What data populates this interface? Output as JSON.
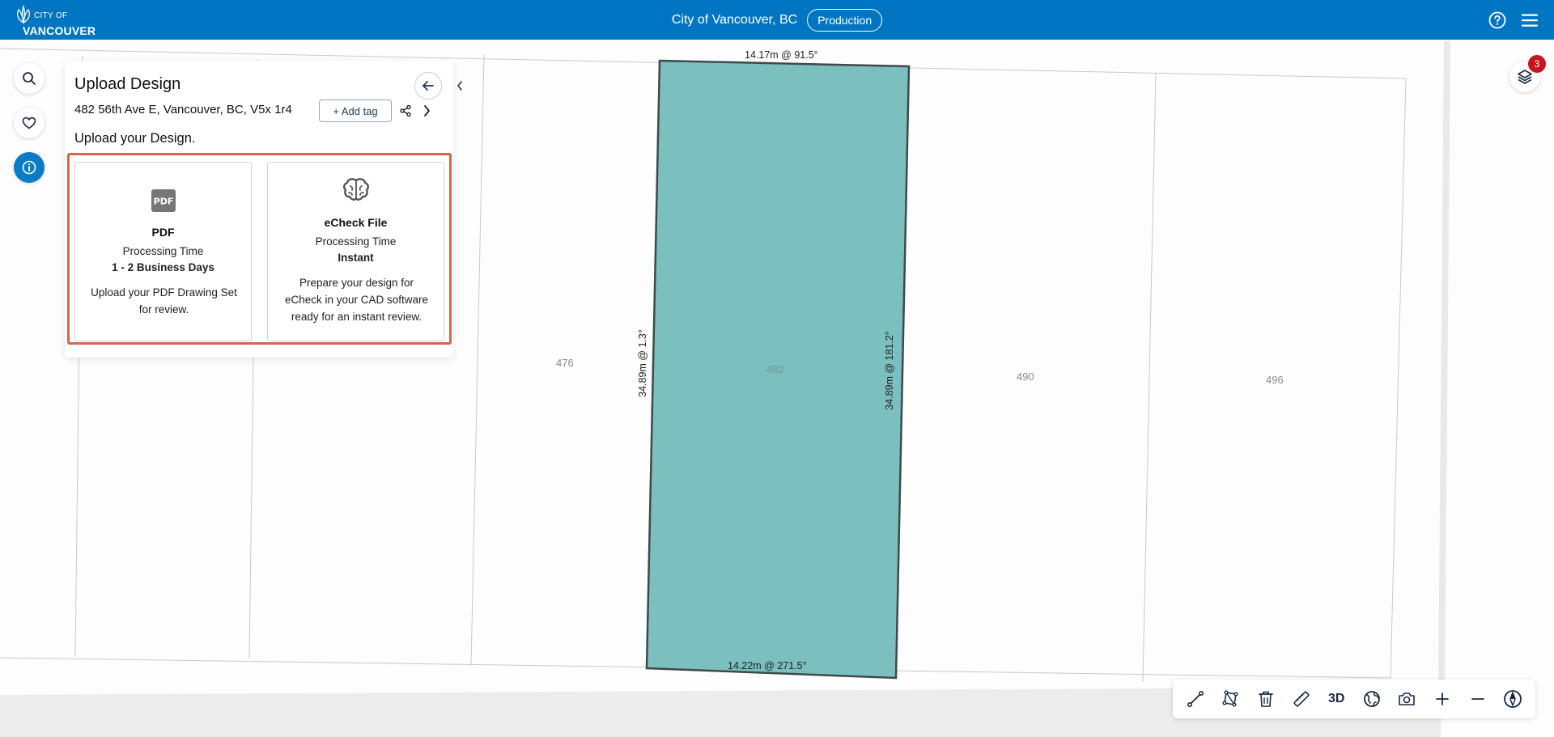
{
  "header": {
    "logo_small": "CITY OF",
    "logo_big": "VANCOUVER",
    "title": "City of Vancouver, BC",
    "environment": "Production"
  },
  "map": {
    "lots": [
      "476",
      "482",
      "490",
      "496"
    ],
    "dimensions": {
      "top": "14.17m @ 91.5°",
      "left": "34.89m @ 1.3°",
      "right": "34.89m @ 181.2°",
      "bottom": "14.22m @ 271.5°"
    },
    "parcel_color": "#7bbfbf",
    "parcel_stroke": "#3e4a4a"
  },
  "layers": {
    "badge_count": "3"
  },
  "panel": {
    "title": "Upload Design",
    "address": "482 56th Ave E, Vancouver, BC, V5x 1r4",
    "add_tag_label": "+ Add tag",
    "section_title": "Upload your Design.",
    "highlight_color": "#d9634b",
    "cards": [
      {
        "icon": "pdf-icon",
        "name": "PDF",
        "time_label": "Processing Time",
        "time_value": "1 - 2 Business Days",
        "desc_line1": "Upload your PDF Drawing Set",
        "desc_line2": "for review."
      },
      {
        "icon": "brain-icon",
        "name": "eCheck File",
        "time_label": "Processing Time",
        "time_value": "Instant",
        "desc_line1": "Prepare your design for",
        "desc_line2": "eCheck in your CAD software",
        "desc_line3": "ready for an instant review."
      }
    ]
  },
  "toolbar": {
    "three_d_label": "3D",
    "tools": [
      "draw-line-icon",
      "draw-polygon-icon",
      "trash-icon",
      "ruler-icon",
      "3d-toggle",
      "globe-icon",
      "camera-icon",
      "zoom-in-icon",
      "zoom-out-icon",
      "compass-icon"
    ]
  },
  "theme": {
    "header_bg": "#0076c3",
    "active_blue": "#0a7bc5",
    "badge_red": "#c4161c"
  }
}
